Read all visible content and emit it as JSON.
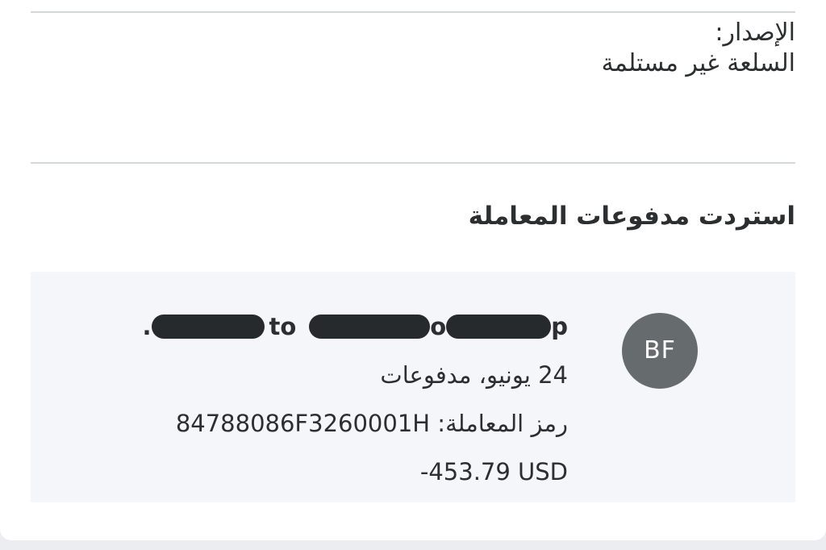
{
  "issue": {
    "label": "الإصدار:",
    "value": "السلعة غير مستلمة"
  },
  "section": {
    "title": "استردت مدفوعات المعاملة"
  },
  "transaction": {
    "avatar_initials": "BF",
    "name_parts": {
      "lead": ".",
      "mid1": "to",
      "mid2": "o",
      "tail": "p"
    },
    "date_type": "24 يونيو، مدفوعات",
    "code_label": "رمز المعاملة:",
    "code_value": "84788086F3260001H",
    "amount": "-453.79 USD"
  }
}
